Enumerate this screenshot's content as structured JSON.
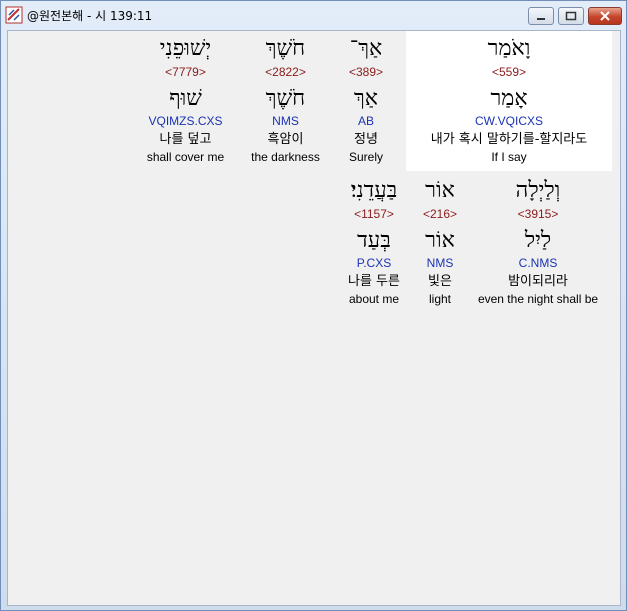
{
  "window": {
    "title": "@원전본해 - 시 139:11"
  },
  "rows": [
    {
      "words": [
        {
          "hebrew": "יְשׁוּפֵנִי",
          "strong": "<7779>",
          "lemma": "שׁוּף",
          "parse": "VQIMZS.CXS",
          "korean": "나를 덮고",
          "english": "shall cover me"
        },
        {
          "hebrew": "חֹשֶׁךְ",
          "strong": "<2822>",
          "lemma": "חֹשֶׁךְ",
          "parse": "NMS",
          "korean": "흑암이",
          "english": "the darkness"
        },
        {
          "hebrew": "אַךְ־",
          "strong": "<389>",
          "lemma": "אַךְ",
          "parse": "AB",
          "korean": "정녕",
          "english": "Surely"
        },
        {
          "hebrew": "וָאֹמַר",
          "strong": "<559>",
          "lemma": "אָמַר",
          "parse": "CW.VQICXS",
          "korean": "내가 혹시 말하기를-할지라도",
          "english": "If I say"
        }
      ]
    },
    {
      "words": [
        {
          "hebrew": "בַּעֲדֵנִי׃",
          "strong": "<1157>",
          "lemma": "בְּעַד",
          "parse": "P.CXS",
          "korean": "나를 두른",
          "english": "about me"
        },
        {
          "hebrew": "אוֹר",
          "strong": "<216>",
          "lemma": "אוֹר",
          "parse": "NMS",
          "korean": "빛은",
          "english": "light"
        },
        {
          "hebrew": "וְלַיְלָה",
          "strong": "<3915>",
          "lemma": "לַיִל",
          "parse": "C.NMS",
          "korean": "밤이되리라",
          "english": "even the night shall be"
        }
      ]
    }
  ]
}
